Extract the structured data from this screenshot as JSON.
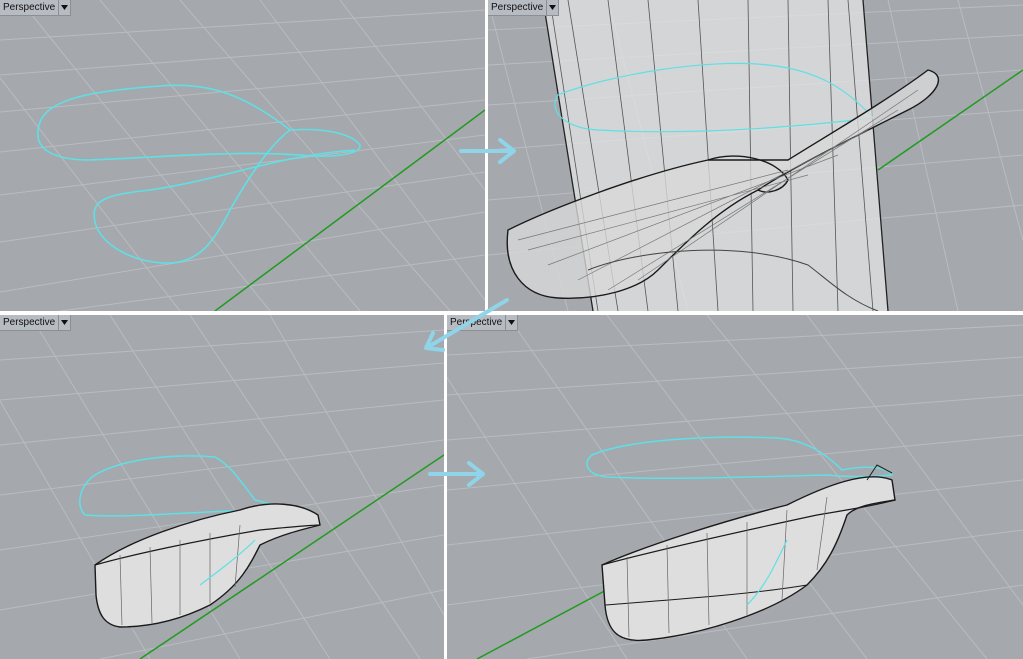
{
  "viewports": [
    {
      "id": "top-left",
      "label": "Perspective"
    },
    {
      "id": "top-right",
      "label": "Perspective"
    },
    {
      "id": "bottom-left",
      "label": "Perspective"
    },
    {
      "id": "bottom-right",
      "label": "Perspective"
    }
  ],
  "colors": {
    "viewport_background": "#a5a8ad",
    "grid_line": "#b8bbc0",
    "x_axis": "#1f9b1f",
    "curve": "#5fe0e6",
    "arrow": "#8fd4e8",
    "solid_surface": "#dcdcdc",
    "edge": "#1a1a1a"
  },
  "icons": {
    "viewport_menu": "triangle-down-icon",
    "flow_arrow": "arrow-right-icon"
  }
}
